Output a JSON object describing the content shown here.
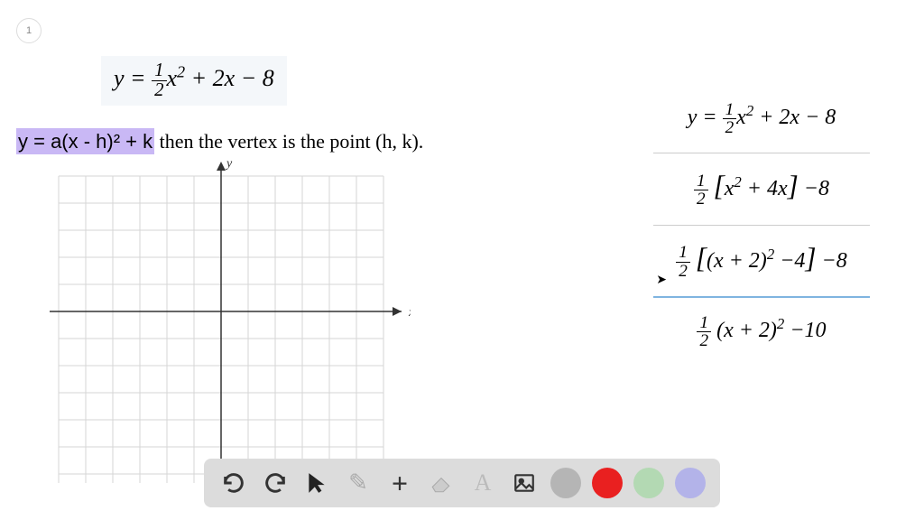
{
  "page_number": "1",
  "main_equation": "y = ½x² + 2x − 8",
  "vertex_form_highlight": "y =  a(x - h)² + k",
  "vertex_form_rest": " then the vertex is the point (h, k).",
  "axis_x": "x",
  "axis_y": "y",
  "steps": {
    "s1": "y = ½x² + 2x − 8",
    "s2": "½ [x² + 4x] −8",
    "s3": "½ [(x + 2)² −4] −8",
    "s4": "½ (x + 2)² −10"
  },
  "toolbar": {
    "undo": "↺",
    "redo": "↻",
    "pointer": "▲",
    "pencil": "✎",
    "plus": "+",
    "eraser": "▱",
    "text": "A",
    "image": "🖼"
  },
  "chart_data": {
    "type": "scatter",
    "title": "",
    "xlabel": "x",
    "ylabel": "y",
    "xlim": [
      -6,
      6
    ],
    "ylim": [
      -7,
      5
    ],
    "series": []
  }
}
